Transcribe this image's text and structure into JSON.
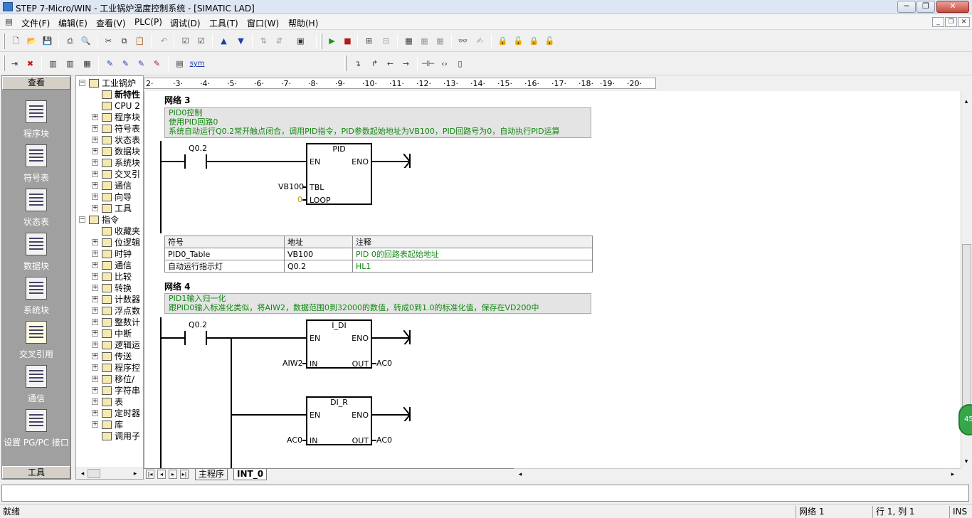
{
  "window": {
    "title": "STEP 7-Micro/WIN - 工业锅炉温度控制系统 - [SIMATIC LAD]",
    "minimize": "─",
    "maximize": "❐",
    "close": "✕"
  },
  "menu": {
    "items": [
      "文件(F)",
      "编辑(E)",
      "查看(V)",
      "PLC(P)",
      "调试(D)",
      "工具(T)",
      "窗口(W)",
      "帮助(H)"
    ],
    "mdi_minimize": "_",
    "mdi_restore": "❐",
    "mdi_close": "✕"
  },
  "toolbar2": {
    "sym_label": "sym"
  },
  "nav": {
    "header": "查看",
    "footer": "工具",
    "items": [
      "程序块",
      "符号表",
      "状态表",
      "数据块",
      "系统块",
      "交叉引用",
      "通信",
      "设置 PG/PC 接口"
    ]
  },
  "tree": {
    "items": [
      {
        "label": "工业锅炉",
        "expander": "−"
      },
      {
        "label": "新特性",
        "expander": ""
      },
      {
        "label": "CPU 2",
        "expander": ""
      },
      {
        "label": "程序块",
        "expander": "+"
      },
      {
        "label": "符号表",
        "expander": "+"
      },
      {
        "label": "状态表",
        "expander": "+"
      },
      {
        "label": "数据块",
        "expander": "+"
      },
      {
        "label": "系统块",
        "expander": "+"
      },
      {
        "label": "交叉引",
        "expander": "+"
      },
      {
        "label": "通信",
        "expander": "+"
      },
      {
        "label": "向导",
        "expander": "+"
      },
      {
        "label": "工具",
        "expander": "+"
      },
      {
        "label": "指令",
        "expander": "−"
      },
      {
        "label": "收藏夹",
        "expander": ""
      },
      {
        "label": "位逻辑",
        "expander": "+"
      },
      {
        "label": "时钟",
        "expander": "+"
      },
      {
        "label": "通信",
        "expander": "+"
      },
      {
        "label": "比较",
        "expander": "+"
      },
      {
        "label": "转换",
        "expander": "+"
      },
      {
        "label": "计数器",
        "expander": "+"
      },
      {
        "label": "浮点数",
        "expander": "+"
      },
      {
        "label": "整数计",
        "expander": "+"
      },
      {
        "label": "中断",
        "expander": "+"
      },
      {
        "label": "逻辑运",
        "expander": "+"
      },
      {
        "label": "传送",
        "expander": "+"
      },
      {
        "label": "程序控",
        "expander": "+"
      },
      {
        "label": "移位/",
        "expander": "+"
      },
      {
        "label": "字符串",
        "expander": "+"
      },
      {
        "label": "表",
        "expander": "+"
      },
      {
        "label": "定时器",
        "expander": "+"
      },
      {
        "label": "库",
        "expander": "+"
      },
      {
        "label": "调用子",
        "expander": ""
      }
    ]
  },
  "ruler": {
    "marks": [
      "2·",
      "·3·",
      "·4·",
      "·5·",
      "·6·",
      "·7·",
      "·8·",
      "·9·",
      "·10·",
      "·11·",
      "·12·",
      "·13·",
      "·14·",
      "·15·",
      "·16·",
      "·17·",
      "·18·",
      "·19·",
      "·20·"
    ]
  },
  "networks": {
    "n3": {
      "title": "网络 3",
      "comment": [
        "PID0控制",
        "使用PID回路0",
        "系统自动运行Q0.2常开触点闭合，调用PID指令，PID参数起始地址为VB100，PID回路号为0，自动执行PID运算"
      ],
      "contact": "Q0.2",
      "box": {
        "name": "PID",
        "en": "EN",
        "eno": "ENO",
        "tbl": "TBL",
        "loop": "LOOP",
        "tbl_operand": "VB100",
        "loop_operand": "0"
      },
      "symbols": {
        "headers": [
          "符号",
          "地址",
          "注释"
        ],
        "rows": [
          [
            "PID0_Table",
            "VB100",
            "PID 0的回路表起始地址"
          ],
          [
            "自动运行指示灯",
            "Q0.2",
            "HL1"
          ]
        ]
      }
    },
    "n4": {
      "title": "网络 4",
      "comment": [
        "PID1输入归一化",
        "跟PID0输入标准化类似，将AIW2，数据范围0到32000的数值，转成0到1.0的标准化值，保存在VD200中"
      ],
      "contact": "Q0.2",
      "box1": {
        "name": "I_DI",
        "en": "EN",
        "eno": "ENO",
        "in": "IN",
        "out": "OUT",
        "in_operand": "AIW2",
        "out_operand": "AC0"
      },
      "box2": {
        "name": "DI_R",
        "en": "EN",
        "eno": "ENO",
        "in": "IN",
        "out": "OUT",
        "in_operand": "AC0",
        "out_operand": "AC0"
      }
    }
  },
  "tabs": [
    "主程序",
    "INT_0"
  ],
  "status": {
    "left": "就绪",
    "network": "网络 1",
    "position": "行 1, 列 1",
    "mode": "INS"
  },
  "float_badge": "45"
}
